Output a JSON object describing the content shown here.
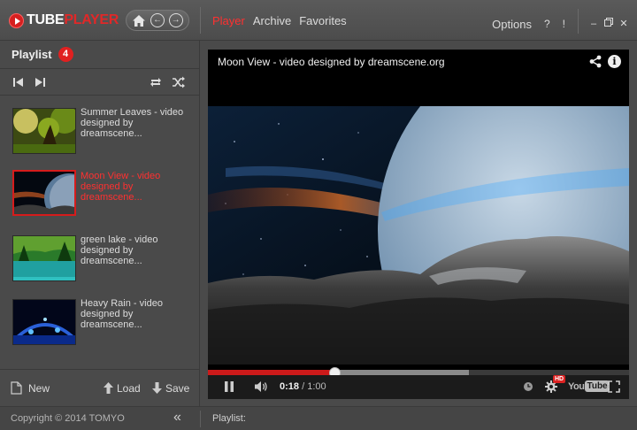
{
  "app": {
    "logo_tube": "TUBE",
    "logo_player": "PLAYER"
  },
  "nav": {
    "tabs": [
      {
        "label": "Player",
        "active": true
      },
      {
        "label": "Archive",
        "active": false
      },
      {
        "label": "Favorites",
        "active": false
      }
    ],
    "options_label": "Options",
    "help_label": "?",
    "alert_label": "!"
  },
  "playlist": {
    "title": "Playlist",
    "count": "4",
    "items": [
      {
        "name": "Summer Leaves - video designed by dreamscene...",
        "active": false
      },
      {
        "name": "Moon View - video designed by dreamscene...",
        "active": true
      },
      {
        "name": "green lake - video designed by dreamscene...",
        "active": false
      },
      {
        "name": "Heavy Rain - video designed by dreamscene...",
        "active": false
      }
    ],
    "new_label": "New",
    "load_label": "Load",
    "save_label": "Save"
  },
  "video": {
    "title": "Moon View - video designed by dreamscene.org",
    "current_time": "0:18",
    "separator": " / ",
    "duration": "1:00",
    "played_fraction": 0.3,
    "buffered_fraction": 0.62,
    "hd_badge": "HD",
    "youtube_you": "You",
    "youtube_tube": "Tube"
  },
  "status": {
    "copyright": "Copyright © 2014 TOMYO",
    "playlist_label": "Playlist:"
  },
  "colors": {
    "accent": "#e02020",
    "background": "#4a4a4a"
  }
}
